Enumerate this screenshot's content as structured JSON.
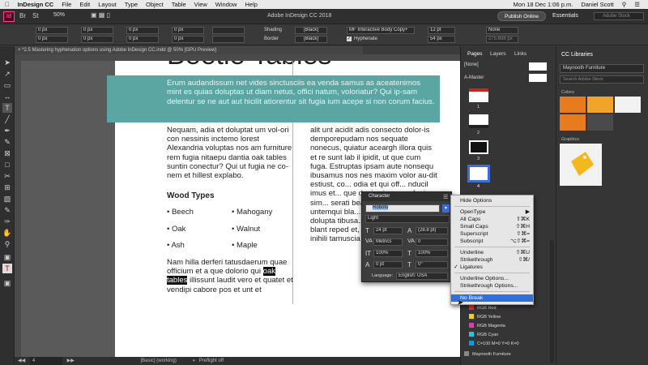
{
  "menubar": {
    "app_name": "InDesign CC",
    "items": [
      "File",
      "Edit",
      "Layout",
      "Type",
      "Object",
      "Table",
      "View",
      "Window",
      "Help"
    ],
    "clock": "Mon 18 Dec 1:06 p.m.",
    "user": "Daniel Scott"
  },
  "appbar": {
    "zoom": "50%",
    "title": "Adobe InDesign CC 2018",
    "publish_label": "Publish Online",
    "workspace": "Essentials",
    "search_placeholder": "Adobe Stock"
  },
  "control": {
    "pt_values": [
      "0 px",
      "0 px",
      "0 px",
      "0 px",
      "0 px",
      "0 px",
      "0 px",
      "0 px"
    ],
    "shading_label": "Shading",
    "border_label": "Border",
    "shading_color": "[Black]",
    "border_color": "[Black]",
    "style": "MF Interactive Body Copy+",
    "hyphenate_label": "Hyphenate",
    "leading_a": "12 pt",
    "leading_b": "54 px",
    "none": "None",
    "width": "275.698 px"
  },
  "document": {
    "tab": "*2.5 Mastering hyphenation options using Adobe InDesign CC.indd @ 50% [GPU Preview]",
    "heading_partial": "Beetle Tables",
    "banner_text": "Erum audandissum net vides sinctusciis ea venda samus as aceatenimos mint es quias doluptas ut diam netus, offici natum, voloriatur? Qui ip-sam delentur se ne aut aut hicilit atiorentur sit fugia ium acepe si non corum facius.",
    "col1_top": "Nequam, adia et doluptat um vol-ori con nessinis inctemo lorest Alexandria voluptas nos am furniture rem fugia nitaepu dantia oak tables suntin conectur? Qui ut fugia ne co-nem et hillest explabo.",
    "wood_heading": "Wood Types",
    "wood_left": [
      "Beech",
      "Oak",
      "Ash"
    ],
    "wood_right": [
      "Mahogany",
      "Walnut",
      "Maple"
    ],
    "col1_bottom_1": "Nam hilla derferi tatusdaerum quae officium et a que dolorio qui",
    "highlight_1": "oak",
    "highlight_2": "tables",
    "col1_bottom_2": "illissunt laudit vero et quatet et vendipi cabore pos et unt et",
    "col2_text": "alit unt acidit adis consecto dolor-is demporepudam nos sequate nonecus, quiatur aceargh illora quis et re sunt lab il ipidit, ut que cum fuga. Estruptas ipsam aute nonsequ ibusamus nos nes maxim volor au-dit estiust, co... odia et qui off... nducil imus et... que denis sin... rum fugia sim... serati beatet ... pera quodiore... untemqui bla... quaest, abo. N... dolupta tibusa... dant ius duciento blant reped et, aut-est, cullacc atquas inihili tamuscia"
  },
  "status": {
    "page": "4",
    "style_label": "[Basic] (working)",
    "preflight": "Preflight off"
  },
  "pages_panel": {
    "tabs": [
      "Pages",
      "Layers",
      "Links"
    ],
    "none": "[None]",
    "master": "A-Master",
    "page_numbers": [
      "1",
      "2",
      "3",
      "4"
    ]
  },
  "swatches": [
    "RGB Red",
    "RGB Yellow",
    "RGB Magenta",
    "RGB Cyan",
    "C=100 M=0 Y=0 K=0",
    "Maynooth Furniture"
  ],
  "swatch_colors": [
    "#e5322d",
    "#f5d20c",
    "#d83fb7",
    "#27c4e6",
    "#00a0e6",
    "#888888"
  ],
  "libraries": {
    "title": "CC Libraries",
    "library": "Maynooth Furniture",
    "search_placeholder": "Search Adobe Stock",
    "colors_label": "Colors",
    "graphics_label": "Graphics",
    "color_values": [
      "#e87b1e",
      "#f0a52a",
      "#f2f2f2",
      "#e87b1e",
      "#4a4a4a"
    ]
  },
  "character": {
    "title": "Character",
    "font": "Roboto",
    "style": "Light",
    "size": "24 pt",
    "leading": "(28.8 pt)",
    "kerning": "Metrics",
    "tracking": "0",
    "vscale": "100%",
    "hscale": "100%",
    "baseline": "0 pt",
    "skew": "0°",
    "language_label": "Language:",
    "language": "English: USA"
  },
  "context_menu": {
    "items": [
      {
        "label": "Hide Options",
        "shortcut": "",
        "checked": false,
        "highlighted": false
      },
      {
        "label": "OpenType",
        "shortcut": "▶",
        "checked": false,
        "highlighted": false
      },
      {
        "label": "All Caps",
        "shortcut": "⇧⌘K",
        "checked": false,
        "highlighted": false
      },
      {
        "label": "Small Caps",
        "shortcut": "⇧⌘H",
        "checked": false,
        "highlighted": false
      },
      {
        "label": "Superscript",
        "shortcut": "⇧⌘=",
        "checked": false,
        "highlighted": false
      },
      {
        "label": "Subscript",
        "shortcut": "⌥⇧⌘=",
        "checked": false,
        "highlighted": false
      },
      {
        "label": "Underline",
        "shortcut": "⇧⌘U",
        "checked": false,
        "highlighted": false
      },
      {
        "label": "Strikethrough",
        "shortcut": "⇧⌘/",
        "checked": false,
        "highlighted": false
      },
      {
        "label": "Ligatures",
        "shortcut": "",
        "checked": true,
        "highlighted": false
      },
      {
        "label": "Underline Options...",
        "shortcut": "",
        "checked": false,
        "highlighted": false
      },
      {
        "label": "Strikethrough Options...",
        "shortcut": "",
        "checked": false,
        "highlighted": false
      },
      {
        "label": "No Break",
        "shortcut": "",
        "checked": false,
        "highlighted": true
      }
    ]
  },
  "colors": {
    "banner": "#5ba6a3",
    "highlight_menu": "#2f6fd8",
    "page": "#ffffff"
  }
}
